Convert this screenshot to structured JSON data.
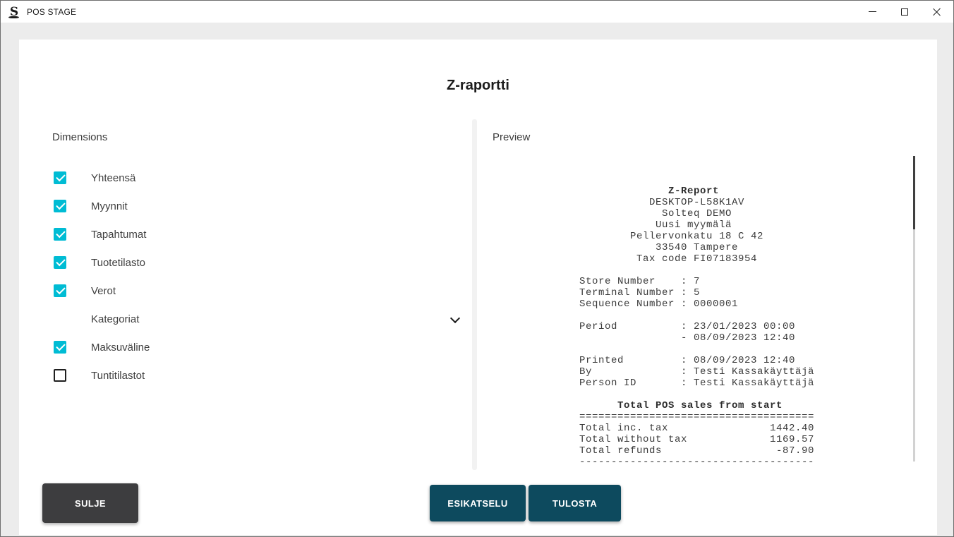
{
  "window": {
    "title": "POS STAGE"
  },
  "dialog": {
    "title": "Z-raportti"
  },
  "dimensions": {
    "label": "Dimensions",
    "items": [
      {
        "label": "Yhteensä",
        "type": "checkbox",
        "checked": true
      },
      {
        "label": "Myynnit",
        "type": "checkbox",
        "checked": true
      },
      {
        "label": "Tapahtumat",
        "type": "checkbox",
        "checked": true
      },
      {
        "label": "Tuotetilasto",
        "type": "checkbox",
        "checked": true
      },
      {
        "label": "Verot",
        "type": "checkbox",
        "checked": true
      },
      {
        "label": "Kategoriat",
        "type": "expander",
        "expanded": false
      },
      {
        "label": "Maksuväline",
        "type": "checkbox",
        "checked": true
      },
      {
        "label": "Tuntitilastot",
        "type": "checkbox",
        "checked": false
      }
    ]
  },
  "preview": {
    "label": "Preview",
    "receipt_lines": [
      {
        "t": "              Z-Report",
        "b": true
      },
      {
        "t": "           DESKTOP-L58K1AV",
        "b": false
      },
      {
        "t": "             Solteq DEMO",
        "b": false
      },
      {
        "t": "            Uusi myymälä",
        "b": false
      },
      {
        "t": "        Pellervonkatu 18 C 42",
        "b": false
      },
      {
        "t": "            33540 Tampere",
        "b": false
      },
      {
        "t": "         Tax code FI07183954",
        "b": false
      },
      {
        "t": "",
        "b": false
      },
      {
        "t": "Store Number    : 7",
        "b": false
      },
      {
        "t": "Terminal Number : 5",
        "b": false
      },
      {
        "t": "Sequence Number : 0000001",
        "b": false
      },
      {
        "t": "",
        "b": false
      },
      {
        "t": "Period          : 23/01/2023 00:00",
        "b": false
      },
      {
        "t": "                - 08/09/2023 12:40",
        "b": false
      },
      {
        "t": "",
        "b": false
      },
      {
        "t": "Printed         : 08/09/2023 12:40",
        "b": false
      },
      {
        "t": "By              : Testi Kassakäyttäjä",
        "b": false
      },
      {
        "t": "Person ID       : Testi Kassakäyttäjä",
        "b": false
      },
      {
        "t": "",
        "b": false
      },
      {
        "t": "      Total POS sales from start",
        "b": true
      },
      {
        "t": "=====================================",
        "b": false
      },
      {
        "t": "Total inc. tax                1442.40",
        "b": false
      },
      {
        "t": "Total without tax             1169.57",
        "b": false
      },
      {
        "t": "Total refunds                  -87.90",
        "b": false
      },
      {
        "t": "-------------------------------------",
        "b": false
      }
    ]
  },
  "buttons": {
    "close": "SULJE",
    "preview": "ESIKATSELU",
    "print": "TULOSTA"
  },
  "colors": {
    "accent": "#00bcd4",
    "button_dark": "#3d3d3f",
    "button_teal": "#0d4a5e",
    "card_bg": "#ffffff",
    "window_bg": "#ececec"
  }
}
